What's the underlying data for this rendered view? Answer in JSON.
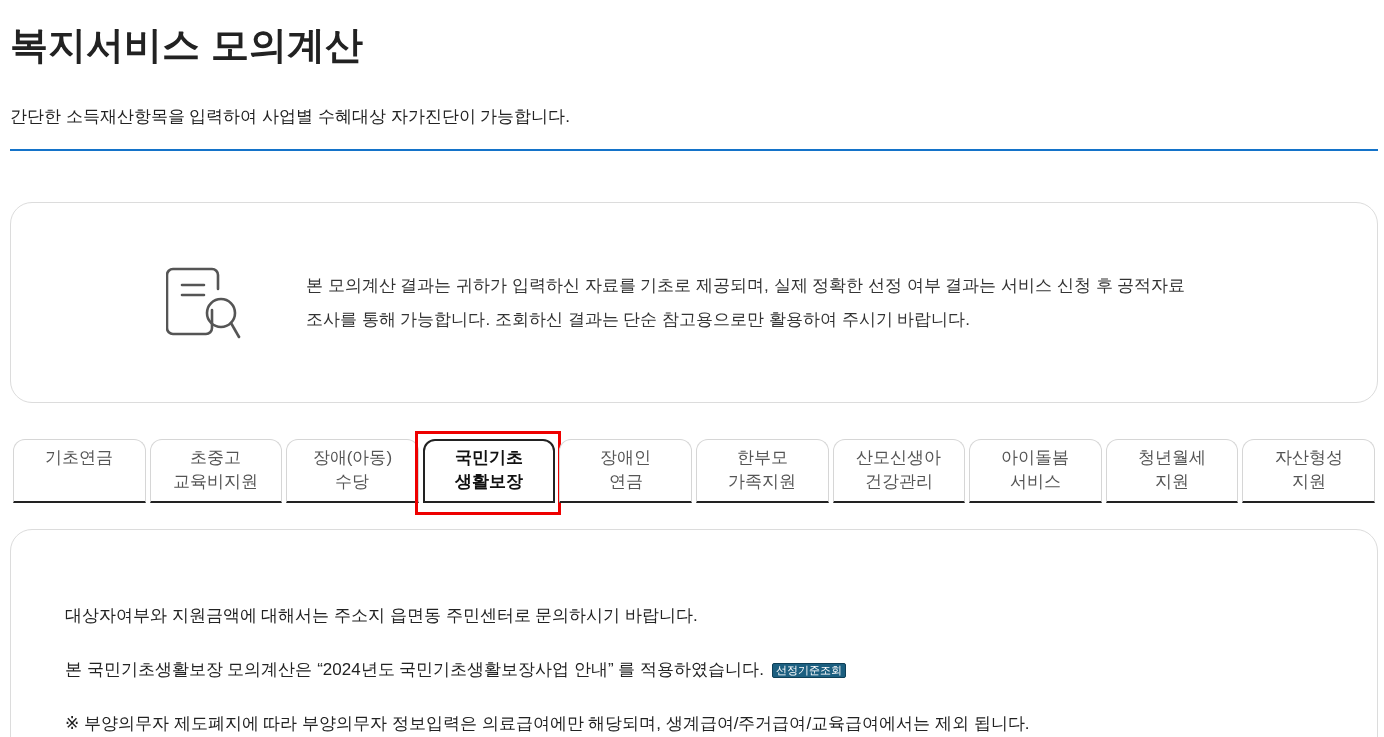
{
  "header": {
    "title": "복지서비스 모의계산",
    "subtitle": "간단한 소득재산항목을 입력하여 사업별 수혜대상 자가진단이 가능합니다."
  },
  "notice": {
    "lines": [
      "본 모의계산 결과는 귀하가 입력하신 자료를 기초로 제공되며, 실제 정확한 선정 여부 결과는 서비스 신청 후 공적자료",
      "조사를 통해 가능합니다. 조회하신 결과는 단순 참고용으로만 활용하여 주시기 바랍니다."
    ]
  },
  "tabs": [
    {
      "lines": [
        "기초연금"
      ],
      "selected": false,
      "highlighted": false
    },
    {
      "lines": [
        "초중고",
        "교육비지원"
      ],
      "selected": false,
      "highlighted": false
    },
    {
      "lines": [
        "장애(아동)",
        "수당"
      ],
      "selected": false,
      "highlighted": false
    },
    {
      "lines": [
        "국민기초",
        "생활보장"
      ],
      "selected": true,
      "highlighted": true
    },
    {
      "lines": [
        "장애인",
        "연금"
      ],
      "selected": false,
      "highlighted": false
    },
    {
      "lines": [
        "한부모",
        "가족지원"
      ],
      "selected": false,
      "highlighted": false
    },
    {
      "lines": [
        "산모신생아",
        "건강관리"
      ],
      "selected": false,
      "highlighted": false
    },
    {
      "lines": [
        "아이돌봄",
        "서비스"
      ],
      "selected": false,
      "highlighted": false
    },
    {
      "lines": [
        "청년월세",
        "지원"
      ],
      "selected": false,
      "highlighted": false
    },
    {
      "lines": [
        "자산형성",
        "지원"
      ],
      "selected": false,
      "highlighted": false
    }
  ],
  "content": {
    "paragraphs": [
      {
        "text": "대상자여부와 지원금액에 대해서는 주소지 읍면동 주민센터로 문의하시기 바랍니다."
      },
      {
        "text": "본 국민기초생활보장 모의계산은 “2024년도 국민기초생활보장사업 안내” 를 적용하였습니다.",
        "button": "선정기준조회"
      },
      {
        "text": "※ 부양의무자 제도폐지에 따라 부양의무자 정보입력은 의료급여에만 해당되며, 생계급여/주거급여/교육급여에서는 제외 됩니다."
      }
    ]
  }
}
